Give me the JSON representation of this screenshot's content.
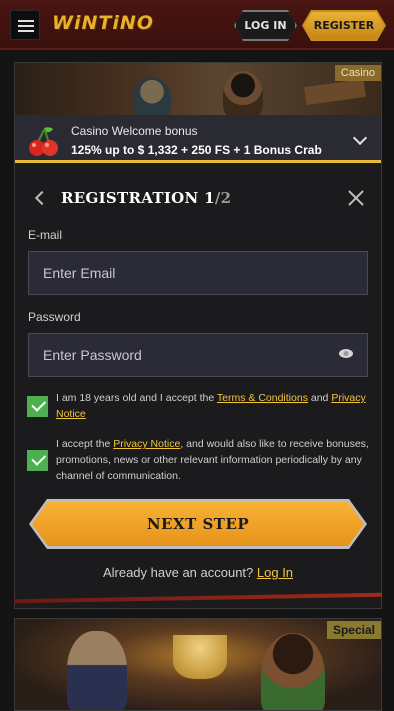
{
  "header": {
    "logo": "WiNTiNO",
    "login_label": "LOG IN",
    "register_label": "REGISTER"
  },
  "promo": {
    "tag": "Casino",
    "bonus_title": "Casino Welcome bonus",
    "bonus_detail": "125% up to $ 1,332 + 250 FS + 1 Bonus Crab"
  },
  "form": {
    "title": "REGISTRATION 1",
    "title_sep": "/",
    "title_total": "2",
    "email_label": "E-mail",
    "email_placeholder": "Enter Email",
    "email_value": "",
    "password_label": "Password",
    "password_placeholder": "Enter Password",
    "password_value": "",
    "consent1_prefix": "I am 18 years old and I accept the ",
    "consent1_terms_link": "Terms & Conditions",
    "consent1_and": " and ",
    "consent1_privacy_link": "Privacy Notice",
    "consent1_checked": true,
    "consent2_prefix": "I accept the ",
    "consent2_privacy_link": "Privacy Notice",
    "consent2_suffix": ", and would also like to receive bonuses, promotions, news or other relevant information periodically by any channel of communication.",
    "consent2_checked": true,
    "next_label": "NEXT STEP",
    "already_text": "Already have an account? ",
    "login_link": "Log In"
  },
  "promo2": {
    "tag": "Special"
  },
  "colors": {
    "accent": "#f3c63a",
    "button": "#f0a02a",
    "check": "#4caf50",
    "header": "#4a1512"
  }
}
